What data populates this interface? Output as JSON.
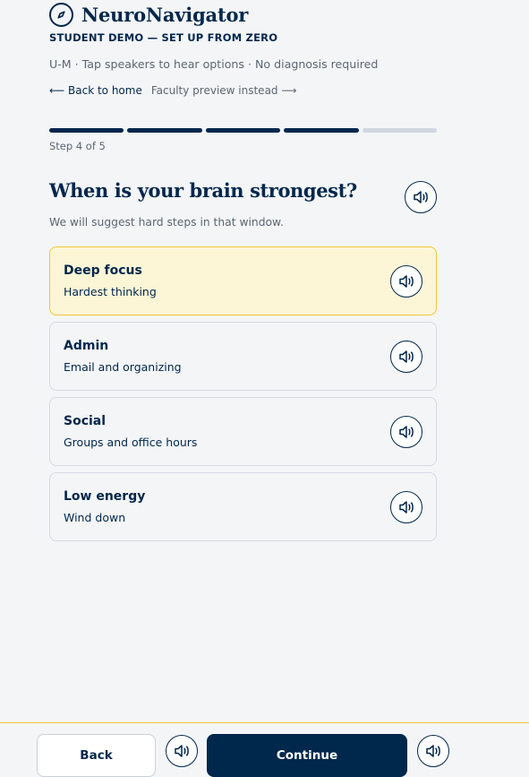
{
  "brand": {
    "name": "NeuroNavigator",
    "icon": "compass-icon"
  },
  "subtitle": "STUDENT DEMO — SET UP FROM ZERO",
  "tagline": "U-M · Tap speakers to hear options · No diagnosis required",
  "links": {
    "home": "⟵ Back to home",
    "faculty": "Faculty preview instead ⟶"
  },
  "progress": {
    "current_step": 4,
    "total_steps": 5,
    "label": "Step 4 of 5"
  },
  "question": {
    "title": "When is your brain strongest?",
    "hint": "We will suggest hard steps in that window.",
    "speaker_icon": "speaker-icon"
  },
  "options": [
    {
      "title": "Deep focus",
      "desc": "Hardest thinking",
      "selected": true
    },
    {
      "title": "Admin",
      "desc": "Email and organizing",
      "selected": false
    },
    {
      "title": "Social",
      "desc": "Groups and office hours",
      "selected": false
    },
    {
      "title": "Low energy",
      "desc": "Wind down",
      "selected": false
    }
  ],
  "footer": {
    "back_label": "Back",
    "continue_label": "Continue"
  },
  "colors": {
    "navy": "#00274c",
    "maize": "#f2c736",
    "selected_bg": "#fdf6d6",
    "muted_text": "#5b6673",
    "progress_inactive": "#cfd7e1"
  }
}
